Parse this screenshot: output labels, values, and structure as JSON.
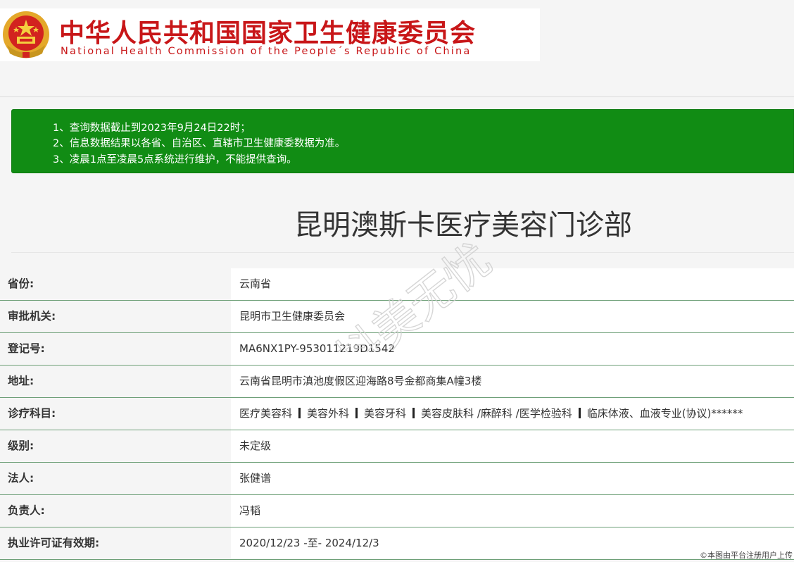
{
  "header": {
    "title_cn": "中华人民共和国国家卫生健康委员会",
    "title_en": "National Health Commission of the People´s Republic of China",
    "emblem_icon": "national-emblem-icon",
    "brand_color": "#c81618"
  },
  "notice": {
    "color": "#118c14",
    "lines": [
      "1、查询数据截止到2023年9月24日22时；",
      "2、信息数据结果以各省、自治区、直辖市卫生健康委数据为准。",
      "3、凌晨1点至凌晨5点系统进行维护，不能提供查询。"
    ]
  },
  "institution": {
    "name": "昆明澳斯卡医疗美容门诊部"
  },
  "details": {
    "rows": [
      {
        "label": "省份:",
        "value": "云南省"
      },
      {
        "label": "审批机关:",
        "value": "昆明市卫生健康委员会"
      },
      {
        "label": "登记号:",
        "value": "MA6NX1PY-953011219D1542"
      },
      {
        "label": "地址:",
        "value": "云南省昆明市滇池度假区迎海路8号金都商集A幢3楼"
      },
      {
        "label": "诊疗科目:",
        "value": ""
      },
      {
        "label": "级别:",
        "value": "未定级"
      },
      {
        "label": "法人:",
        "value": "张健谱"
      },
      {
        "label": "负责人:",
        "value": "冯韬"
      },
      {
        "label": "执业许可证有效期:",
        "value": "2020/12/23 -至- 2024/12/3"
      }
    ],
    "subjects": [
      "医疗美容科",
      "美容外科",
      "美容牙科",
      "美容皮肤科 /麻醉科 /医学检验科",
      "临床体液、血液专业(协议)******"
    ]
  },
  "watermark": {
    "text": "抖美无忧"
  },
  "footer": {
    "note": "©本图由平台注册用户上传"
  }
}
